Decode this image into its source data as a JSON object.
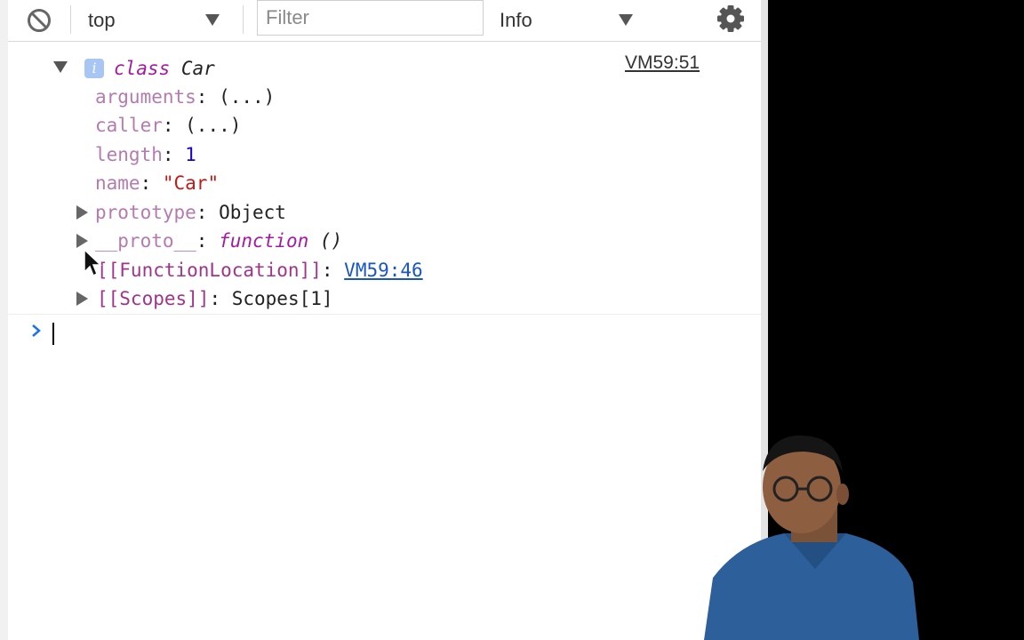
{
  "toolbar": {
    "context_value": "top",
    "filter_placeholder": "Filter",
    "level_value": "Info"
  },
  "console": {
    "entry": {
      "keyword": "class",
      "class_name": "Car",
      "source": "VM59:51",
      "properties": [
        {
          "name": "arguments",
          "value": "(...)"
        },
        {
          "name": "caller",
          "value": "(...)"
        },
        {
          "name": "length",
          "value": "1"
        },
        {
          "name": "name",
          "value": "\"Car\""
        },
        {
          "name": "prototype",
          "value": "Object"
        },
        {
          "name": "__proto__",
          "value_keyword": "function",
          "value": "()"
        },
        {
          "name": "[[FunctionLocation]]",
          "value": "VM59:46"
        },
        {
          "name": "[[Scopes]]",
          "value": "Scopes[1]"
        }
      ]
    }
  },
  "colors": {
    "keyword": "#a31ba0",
    "property": "#a1348a",
    "number": "#1c00cf",
    "string": "#c41a16",
    "link": "#1a55c6",
    "prompt": "#1a73e8"
  }
}
